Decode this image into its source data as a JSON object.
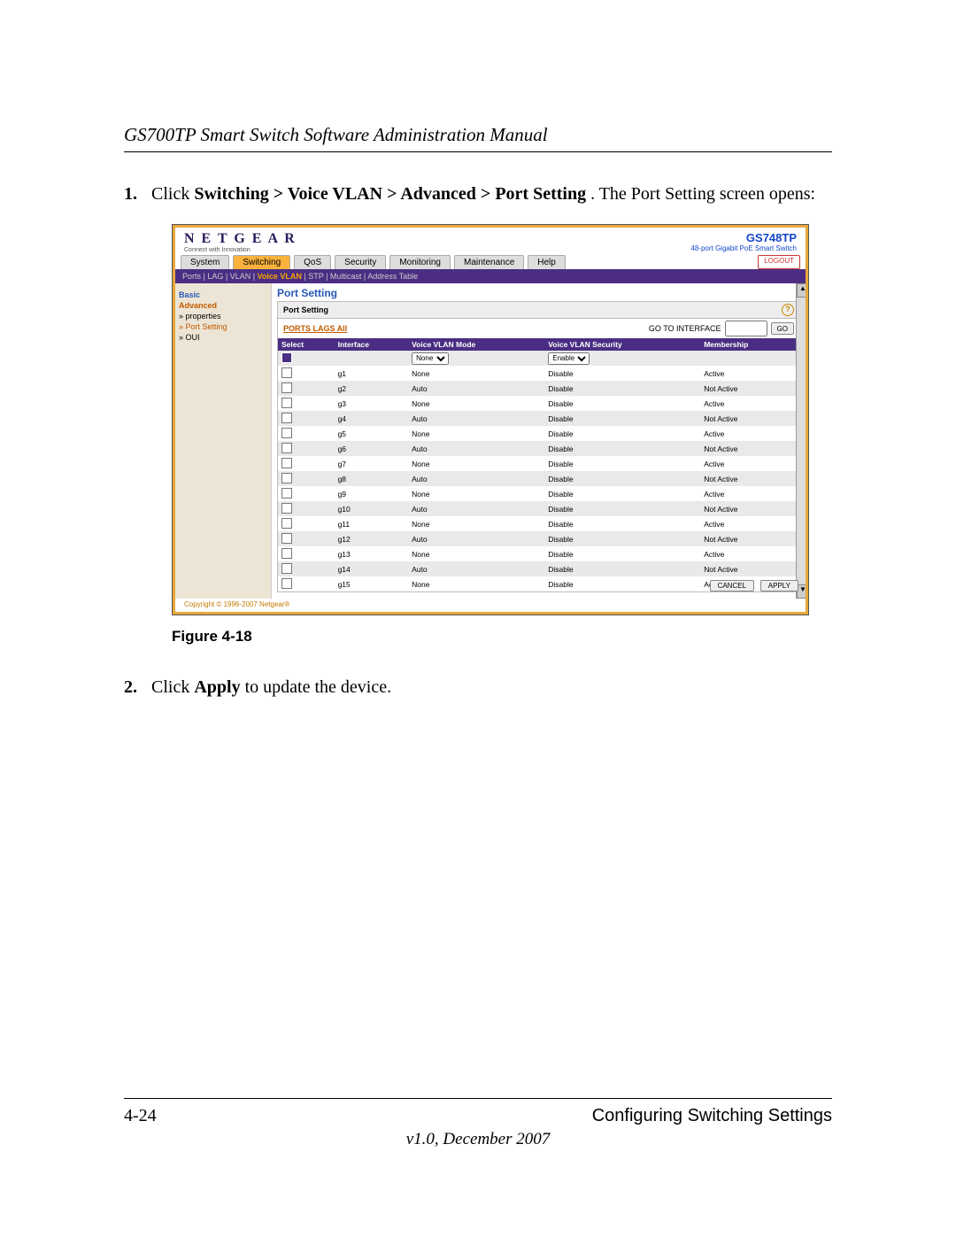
{
  "doc": {
    "header": "GS700TP Smart Switch Software Administration Manual",
    "step1_num": "1.",
    "step1_a": "Click ",
    "step1_b": "Switching > Voice VLAN > Advanced > Port Setting",
    "step1_c": ". The Port Setting screen opens:",
    "figure": "Figure 4-18",
    "step2_num": "2.",
    "step2_a": "Click ",
    "step2_b": "Apply",
    "step2_c": " to update the device.",
    "page_num": "4-24",
    "chapter": "Configuring Switching Settings",
    "version": "v1.0, December 2007"
  },
  "ui": {
    "logo": "N E T G E A R",
    "logo_sub": "Connect with Innovation",
    "model": "GS748TP",
    "model_sub": "48-port Gigabit PoE Smart Switch",
    "tabs": [
      "System",
      "Switching",
      "QoS",
      "Security",
      "Monitoring",
      "Maintenance",
      "Help"
    ],
    "active_tab": 1,
    "logout": "LOGOUT",
    "subnav": "Ports | LAG | VLAN | Voice VLAN | STP | Multicast | Address Table",
    "side": {
      "basic": "Basic",
      "advanced": "Advanced",
      "properties": "» properties",
      "portsetting": "» Port Setting",
      "oui": "» OUI"
    },
    "pane_title": "Port Setting",
    "box_title": "Port Setting",
    "ports_link": "PORTS LAGS All",
    "goto_label": "GO TO INTERFACE",
    "go_btn": "GO",
    "cols": [
      "Select",
      "Interface",
      "Voice VLAN Mode",
      "Voice VLAN Security",
      "Membership"
    ],
    "mode_sel": "None",
    "sec_sel": "Enable",
    "rows": [
      {
        "if": "g1",
        "mode": "None",
        "sec": "Disable",
        "mem": "Active"
      },
      {
        "if": "g2",
        "mode": "Auto",
        "sec": "Disable",
        "mem": "Not Active"
      },
      {
        "if": "g3",
        "mode": "None",
        "sec": "Disable",
        "mem": "Active"
      },
      {
        "if": "g4",
        "mode": "Auto",
        "sec": "Disable",
        "mem": "Not Active"
      },
      {
        "if": "g5",
        "mode": "None",
        "sec": "Disable",
        "mem": "Active"
      },
      {
        "if": "g6",
        "mode": "Auto",
        "sec": "Disable",
        "mem": "Not Active"
      },
      {
        "if": "g7",
        "mode": "None",
        "sec": "Disable",
        "mem": "Active"
      },
      {
        "if": "g8",
        "mode": "Auto",
        "sec": "Disable",
        "mem": "Not Active"
      },
      {
        "if": "g9",
        "mode": "None",
        "sec": "Disable",
        "mem": "Active"
      },
      {
        "if": "g10",
        "mode": "Auto",
        "sec": "Disable",
        "mem": "Not Active"
      },
      {
        "if": "g11",
        "mode": "None",
        "sec": "Disable",
        "mem": "Active"
      },
      {
        "if": "g12",
        "mode": "Auto",
        "sec": "Disable",
        "mem": "Not Active"
      },
      {
        "if": "g13",
        "mode": "None",
        "sec": "Disable",
        "mem": "Active"
      },
      {
        "if": "g14",
        "mode": "Auto",
        "sec": "Disable",
        "mem": "Not Active"
      },
      {
        "if": "g15",
        "mode": "None",
        "sec": "Disable",
        "mem": "Active"
      }
    ],
    "cancel": "CANCEL",
    "apply": "APPLY",
    "copyright": "Copyright © 1996-2007 Netgear®"
  }
}
